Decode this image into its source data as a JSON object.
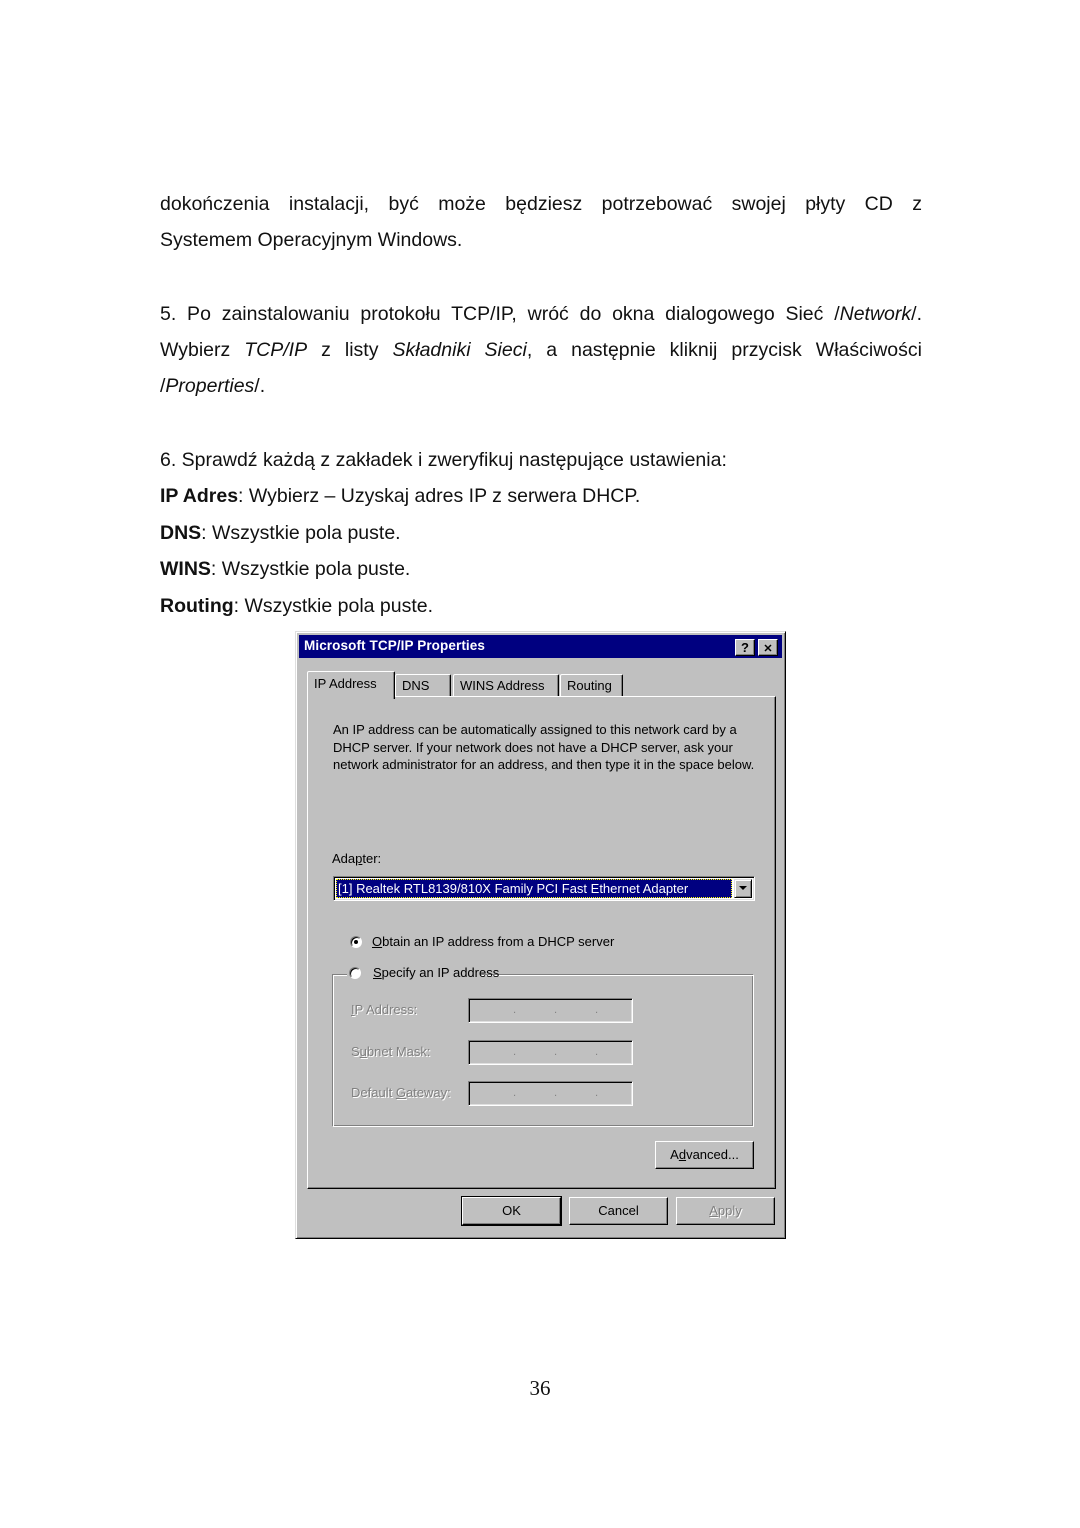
{
  "document": {
    "para1": {
      "line1": "dokończenia instalacji, być może będziesz potrzebować swojej płyty CD z",
      "line2": "Systemem Operacyjnym Windows."
    },
    "para2": {
      "a": "5. Po zainstalowaniu protokołu TCP/IP, wróć do okna dialogowego Sieć /",
      "b_italic": "Network",
      "c": "/. Wybierz ",
      "d_italic": "TCP/IP",
      "e": " z listy ",
      "f_italic": "Składniki Sieci",
      "g": ", a następnie kliknij przycisk Właściwości /",
      "h_italic": "Properties",
      "i": "/."
    },
    "para3": {
      "intro": "6. Sprawdź każdą z zakładek i zweryfikuj następujące ustawienia:",
      "items": [
        {
          "label": "IP Adres",
          "text": ": Wybierz – Uzyskaj adres IP z serwera DHCP."
        },
        {
          "label": "DNS",
          "text": ": Wszystkie pola puste."
        },
        {
          "label": "WINS",
          "text": ": Wszystkie pola puste."
        },
        {
          "label": "Routing",
          "text": ": Wszystkie pola puste."
        }
      ]
    },
    "page_number": "36"
  },
  "dialog": {
    "title": "Microsoft TCP/IP Properties",
    "help_glyph": "?",
    "close_glyph": "✕",
    "tabs": [
      {
        "label": "IP Address",
        "active": true
      },
      {
        "label": "DNS",
        "active": false
      },
      {
        "label": "WINS Address",
        "active": false
      },
      {
        "label": "Routing",
        "active": false
      }
    ],
    "description": "An IP address can be automatically assigned to this network card by a DHCP server.  If your network does not have a DHCP server, ask your network administrator for an address, and then type it in the space below.",
    "adapter": {
      "label_pre": "Ada",
      "label_u": "p",
      "label_post": "ter:",
      "selected": "[1] Realtek RTL8139/810X Family PCI Fast Ethernet Adapter"
    },
    "radio_obtain": {
      "u": "O",
      "rest": "btain an IP address from a DHCP server",
      "checked": true
    },
    "radio_specify": {
      "u": "S",
      "rest": "pecify an IP address",
      "checked": false
    },
    "fields": [
      {
        "pre": "",
        "u": "I",
        "post": "P Address:",
        "value": ""
      },
      {
        "pre": "S",
        "u": "u",
        "post": "bnet Mask:",
        "value": ""
      },
      {
        "pre": "Default ",
        "u": "G",
        "post": "ateway:",
        "value": ""
      }
    ],
    "buttons": {
      "advanced": {
        "pre": "A",
        "u": "d",
        "post": "vanced..."
      },
      "ok": "OK",
      "cancel": "Cancel",
      "apply": {
        "u": "A",
        "post": "pply",
        "enabled": false
      }
    }
  }
}
